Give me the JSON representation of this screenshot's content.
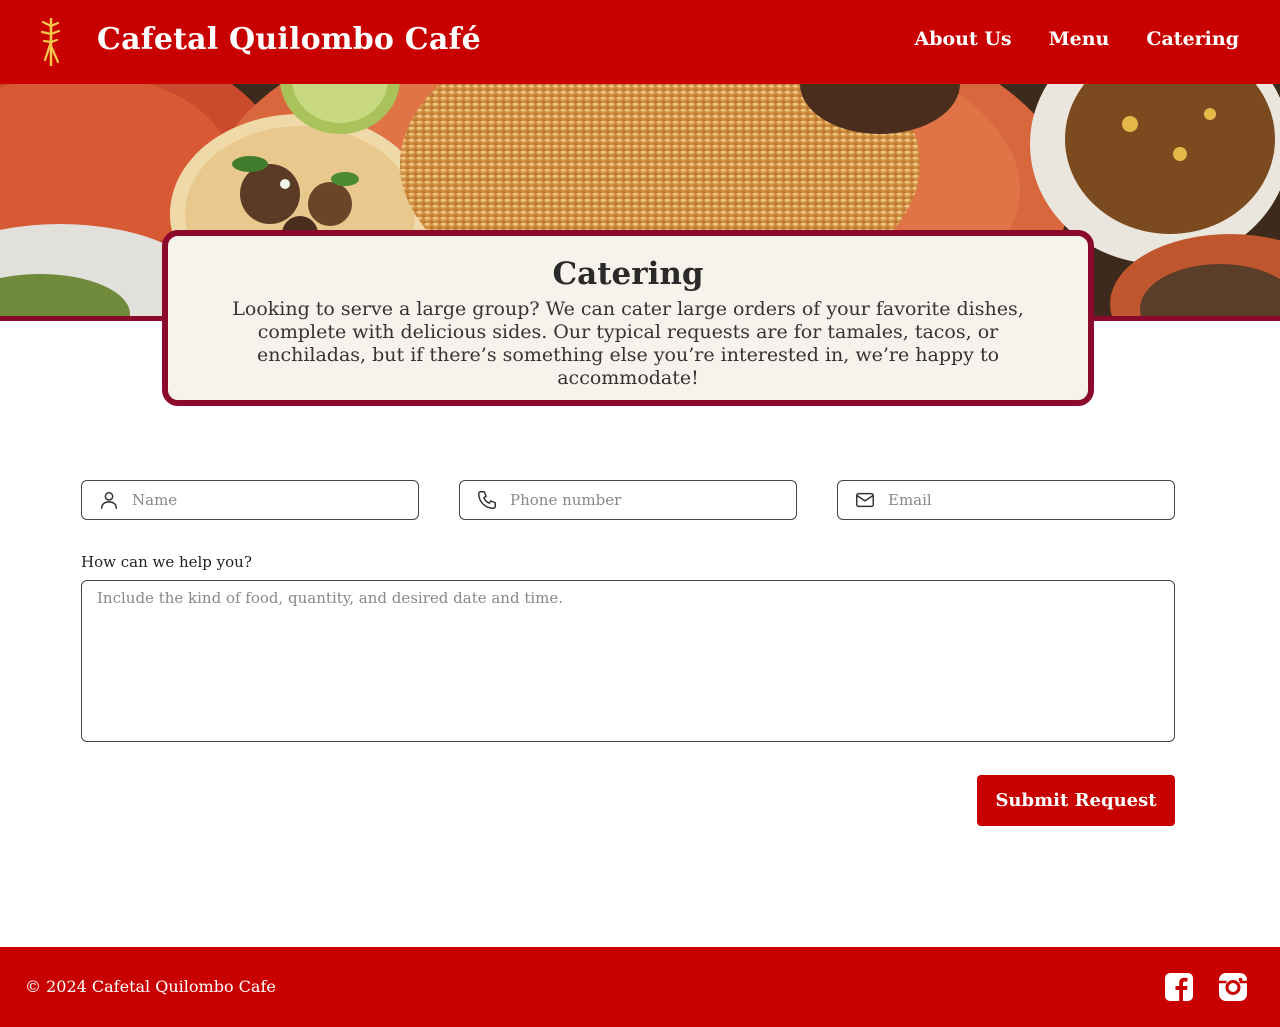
{
  "header": {
    "brand": "Cafetal Quilombo Café",
    "nav": [
      "About Us",
      "Menu",
      "Catering"
    ],
    "logo_icon": "wheat-stalk-logo"
  },
  "hero": {
    "image": "food-platter-photo",
    "card_title": "Catering",
    "card_text": "Looking to serve a large group? We can cater large orders of your favorite dishes, complete with delicious sides. Our typical requests are for tamales, tacos, or enchiladas, but if there’s something else you’re interested in, we’re happy to accommodate!"
  },
  "form": {
    "name_placeholder": "Name",
    "phone_placeholder": "Phone number",
    "email_placeholder": "Email",
    "help_label": "How can we help you?",
    "help_placeholder": "Include the kind of food, quantity, and desired date and time.",
    "submit_label": "Submit Request"
  },
  "footer": {
    "copyright": "© 2024 Cafetal Quilombo Cafe",
    "social": [
      "facebook-icon",
      "instagram-icon"
    ]
  },
  "colors": {
    "brand_red": "#c90000",
    "card_border": "#8b0a2c",
    "card_bg": "#f7f3ec",
    "logo_yellow": "#f5c84a"
  }
}
